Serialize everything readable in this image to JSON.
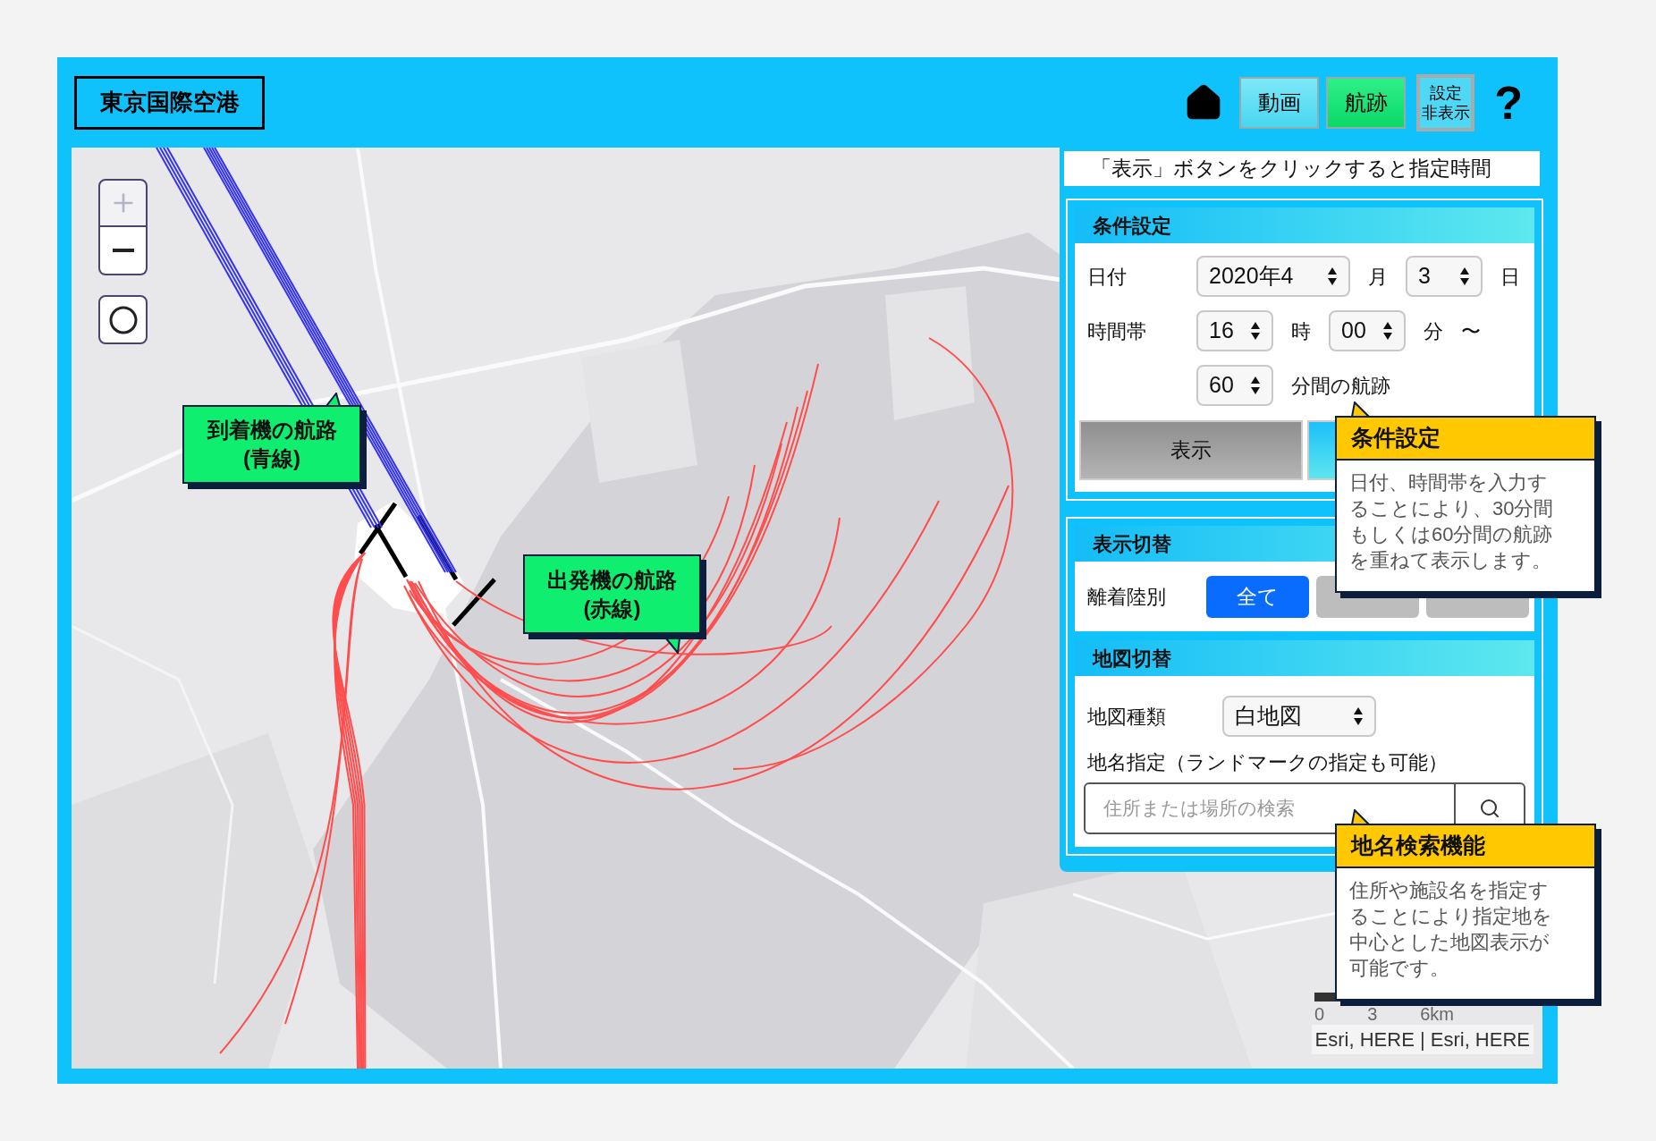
{
  "header": {
    "title": "東京国際空港",
    "nav_buttons": [
      {
        "label": "動画",
        "selected": false
      },
      {
        "label": "航跡",
        "selected": true
      }
    ],
    "settings_toggle": {
      "lines": [
        "設定",
        "非表示"
      ]
    },
    "help": "?"
  },
  "map": {
    "callouts": [
      {
        "kind": "arrival",
        "lines": [
          "到着機の航路",
          "(青線)"
        ]
      },
      {
        "kind": "departure",
        "lines": [
          "出発機の航路",
          "(赤線)"
        ]
      }
    ],
    "scale_labels": [
      "0",
      "3",
      "6km"
    ],
    "attribution": "Esri, HERE | Esri, HERE"
  },
  "panel": {
    "notice": "「表示」ボタンをクリックすると指定時間",
    "conditions": {
      "title": "条件設定",
      "rows": [
        {
          "label": "日付",
          "items": [
            {
              "kind": "select",
              "value": "2020年4"
            },
            {
              "kind": "text",
              "text": "月"
            },
            {
              "kind": "select",
              "value": "3"
            },
            {
              "kind": "text",
              "text": "日"
            }
          ]
        },
        {
          "label": "時間帯",
          "items": [
            {
              "kind": "select",
              "value": "16"
            },
            {
              "kind": "text",
              "text": "時"
            },
            {
              "kind": "select",
              "value": "00"
            },
            {
              "kind": "text",
              "text": "分"
            },
            {
              "kind": "text",
              "text": "〜"
            }
          ]
        },
        {
          "items": [
            {
              "kind": "select",
              "value": "60"
            },
            {
              "kind": "text",
              "text": "分間の航跡"
            }
          ]
        }
      ],
      "buttons": [
        {
          "kind": "gray",
          "label": "表示"
        },
        {
          "kind": "blue"
        }
      ]
    },
    "display": {
      "title": "表示切替",
      "label": "離着陸別",
      "filters": [
        {
          "label": "全て",
          "selected": true
        },
        {
          "selected": false
        },
        {
          "selected": false
        }
      ]
    },
    "map_switch": {
      "title": "地図切替",
      "type_label": "地図種類",
      "type_value": "白地図",
      "place_label": "地名指定（ランドマークの指定も可能）",
      "search": {
        "placeholder": "住所または場所の検索"
      }
    }
  },
  "tooltips": [
    {
      "title": "条件設定",
      "body_lines": [
        "日付、時間帯を入力す",
        "ることにより、30分間",
        "もしくは60分間の航跡",
        "を重ねて表示します。"
      ]
    },
    {
      "title": "地名検索機能",
      "body_lines": [
        "住所や施設名を指定す",
        "ることにより指定地を",
        "中心とした地図表示が",
        "可能です。"
      ]
    }
  ]
}
